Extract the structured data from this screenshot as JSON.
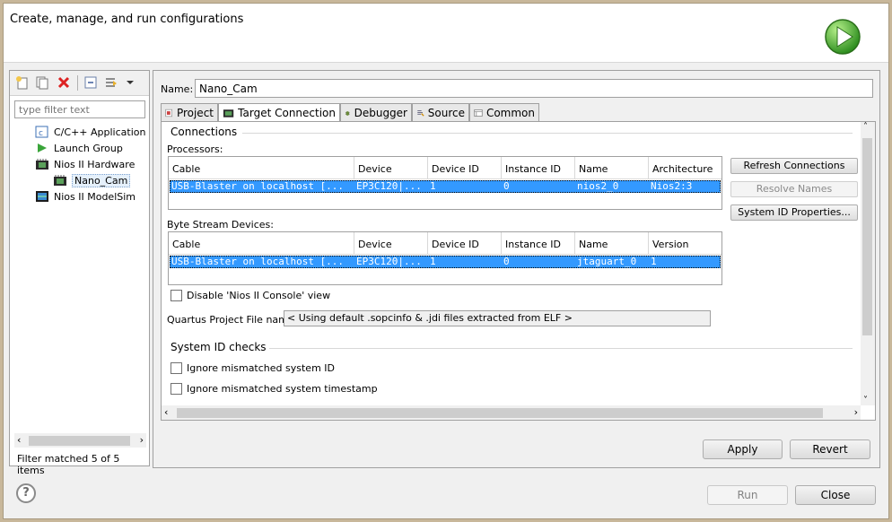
{
  "banner": {
    "title": "Create, manage, and run configurations"
  },
  "left": {
    "filter_placeholder": "type filter text",
    "tree": [
      {
        "label": "C/C++ Application",
        "icon": "c-application-icon"
      },
      {
        "label": "Launch Group",
        "icon": "launch-group-icon"
      },
      {
        "label": "Nios II Hardware",
        "icon": "nios-hardware-icon"
      },
      {
        "label": "Nano_Cam",
        "icon": "nios-hardware-icon",
        "selected": true
      },
      {
        "label": "Nios II ModelSim",
        "icon": "modelsim-icon"
      }
    ],
    "status": "Filter matched 5 of 5 items"
  },
  "config": {
    "name_label": "Name:",
    "name_value": "Nano_Cam",
    "tabs": [
      "Project",
      "Target Connection",
      "Debugger",
      "Source",
      "Common"
    ],
    "active_tab": "Target Connection"
  },
  "connections": {
    "title": "Connections",
    "processors_label": "Processors:",
    "processors_cols": [
      "Cable",
      "Device",
      "Device ID",
      "Instance ID",
      "Name",
      "Architecture"
    ],
    "processors_row": [
      "USB-Blaster on localhost [...",
      "EP3C120|...",
      "1",
      "0",
      "nios2_0",
      "Nios2:3"
    ],
    "bytestream_label": "Byte Stream Devices:",
    "bytestream_cols": [
      "Cable",
      "Device",
      "Device ID",
      "Instance ID",
      "Name",
      "Version"
    ],
    "bytestream_row": [
      "USB-Blaster on localhost [...",
      "EP3C120|...",
      "1",
      "0",
      "jtaguart_0",
      "1"
    ],
    "refresh_label": "Refresh Connections",
    "resolve_label": "Resolve Names",
    "sysid_label": "System ID Properties...",
    "disable_console_label": "Disable 'Nios II Console' view",
    "quartus_label": "Quartus Project File name:",
    "quartus_value": "< Using default .sopcinfo & .jdi files extracted from ELF >"
  },
  "sysid": {
    "title": "System ID checks",
    "ignore_id_label": "Ignore mismatched system ID",
    "ignore_ts_label": "Ignore mismatched system timestamp"
  },
  "buttons": {
    "apply": "Apply",
    "revert": "Revert",
    "run": "Run",
    "close": "Close",
    "help": "?"
  }
}
